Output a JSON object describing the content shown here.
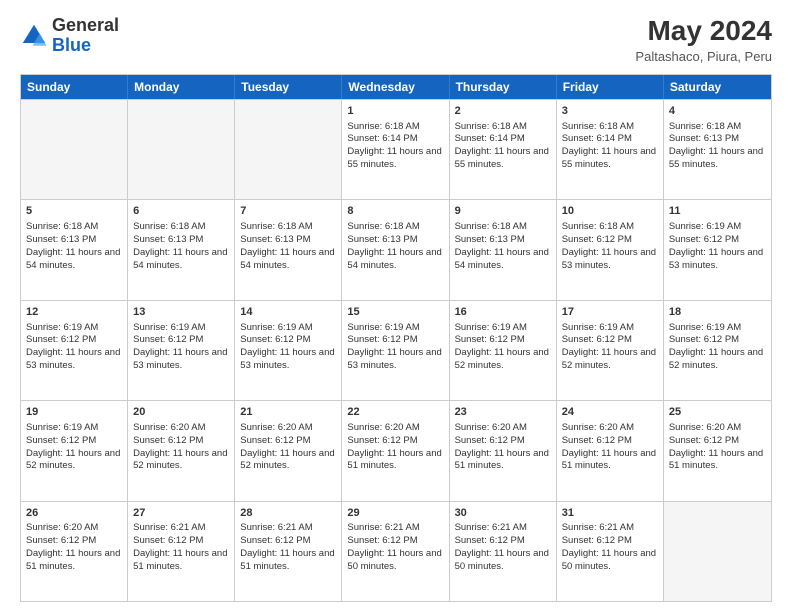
{
  "logo": {
    "general": "General",
    "blue": "Blue"
  },
  "title": "May 2024",
  "subtitle": "Paltashaco, Piura, Peru",
  "days": [
    "Sunday",
    "Monday",
    "Tuesday",
    "Wednesday",
    "Thursday",
    "Friday",
    "Saturday"
  ],
  "weeks": [
    [
      {
        "day": "",
        "empty": true
      },
      {
        "day": "",
        "empty": true
      },
      {
        "day": "",
        "empty": true
      },
      {
        "day": "1",
        "sunrise": "6:18 AM",
        "sunset": "6:14 PM",
        "daylight": "11 hours and 55 minutes."
      },
      {
        "day": "2",
        "sunrise": "6:18 AM",
        "sunset": "6:14 PM",
        "daylight": "11 hours and 55 minutes."
      },
      {
        "day": "3",
        "sunrise": "6:18 AM",
        "sunset": "6:14 PM",
        "daylight": "11 hours and 55 minutes."
      },
      {
        "day": "4",
        "sunrise": "6:18 AM",
        "sunset": "6:13 PM",
        "daylight": "11 hours and 55 minutes."
      }
    ],
    [
      {
        "day": "5",
        "sunrise": "6:18 AM",
        "sunset": "6:13 PM",
        "daylight": "11 hours and 54 minutes."
      },
      {
        "day": "6",
        "sunrise": "6:18 AM",
        "sunset": "6:13 PM",
        "daylight": "11 hours and 54 minutes."
      },
      {
        "day": "7",
        "sunrise": "6:18 AM",
        "sunset": "6:13 PM",
        "daylight": "11 hours and 54 minutes."
      },
      {
        "day": "8",
        "sunrise": "6:18 AM",
        "sunset": "6:13 PM",
        "daylight": "11 hours and 54 minutes."
      },
      {
        "day": "9",
        "sunrise": "6:18 AM",
        "sunset": "6:13 PM",
        "daylight": "11 hours and 54 minutes."
      },
      {
        "day": "10",
        "sunrise": "6:18 AM",
        "sunset": "6:12 PM",
        "daylight": "11 hours and 53 minutes."
      },
      {
        "day": "11",
        "sunrise": "6:19 AM",
        "sunset": "6:12 PM",
        "daylight": "11 hours and 53 minutes."
      }
    ],
    [
      {
        "day": "12",
        "sunrise": "6:19 AM",
        "sunset": "6:12 PM",
        "daylight": "11 hours and 53 minutes."
      },
      {
        "day": "13",
        "sunrise": "6:19 AM",
        "sunset": "6:12 PM",
        "daylight": "11 hours and 53 minutes."
      },
      {
        "day": "14",
        "sunrise": "6:19 AM",
        "sunset": "6:12 PM",
        "daylight": "11 hours and 53 minutes."
      },
      {
        "day": "15",
        "sunrise": "6:19 AM",
        "sunset": "6:12 PM",
        "daylight": "11 hours and 53 minutes."
      },
      {
        "day": "16",
        "sunrise": "6:19 AM",
        "sunset": "6:12 PM",
        "daylight": "11 hours and 52 minutes."
      },
      {
        "day": "17",
        "sunrise": "6:19 AM",
        "sunset": "6:12 PM",
        "daylight": "11 hours and 52 minutes."
      },
      {
        "day": "18",
        "sunrise": "6:19 AM",
        "sunset": "6:12 PM",
        "daylight": "11 hours and 52 minutes."
      }
    ],
    [
      {
        "day": "19",
        "sunrise": "6:19 AM",
        "sunset": "6:12 PM",
        "daylight": "11 hours and 52 minutes."
      },
      {
        "day": "20",
        "sunrise": "6:20 AM",
        "sunset": "6:12 PM",
        "daylight": "11 hours and 52 minutes."
      },
      {
        "day": "21",
        "sunrise": "6:20 AM",
        "sunset": "6:12 PM",
        "daylight": "11 hours and 52 minutes."
      },
      {
        "day": "22",
        "sunrise": "6:20 AM",
        "sunset": "6:12 PM",
        "daylight": "11 hours and 51 minutes."
      },
      {
        "day": "23",
        "sunrise": "6:20 AM",
        "sunset": "6:12 PM",
        "daylight": "11 hours and 51 minutes."
      },
      {
        "day": "24",
        "sunrise": "6:20 AM",
        "sunset": "6:12 PM",
        "daylight": "11 hours and 51 minutes."
      },
      {
        "day": "25",
        "sunrise": "6:20 AM",
        "sunset": "6:12 PM",
        "daylight": "11 hours and 51 minutes."
      }
    ],
    [
      {
        "day": "26",
        "sunrise": "6:20 AM",
        "sunset": "6:12 PM",
        "daylight": "11 hours and 51 minutes."
      },
      {
        "day": "27",
        "sunrise": "6:21 AM",
        "sunset": "6:12 PM",
        "daylight": "11 hours and 51 minutes."
      },
      {
        "day": "28",
        "sunrise": "6:21 AM",
        "sunset": "6:12 PM",
        "daylight": "11 hours and 51 minutes."
      },
      {
        "day": "29",
        "sunrise": "6:21 AM",
        "sunset": "6:12 PM",
        "daylight": "11 hours and 50 minutes."
      },
      {
        "day": "30",
        "sunrise": "6:21 AM",
        "sunset": "6:12 PM",
        "daylight": "11 hours and 50 minutes."
      },
      {
        "day": "31",
        "sunrise": "6:21 AM",
        "sunset": "6:12 PM",
        "daylight": "11 hours and 50 minutes."
      },
      {
        "day": "",
        "empty": true
      }
    ]
  ],
  "cell_labels": {
    "sunrise": "Sunrise:",
    "sunset": "Sunset:",
    "daylight": "Daylight:"
  }
}
